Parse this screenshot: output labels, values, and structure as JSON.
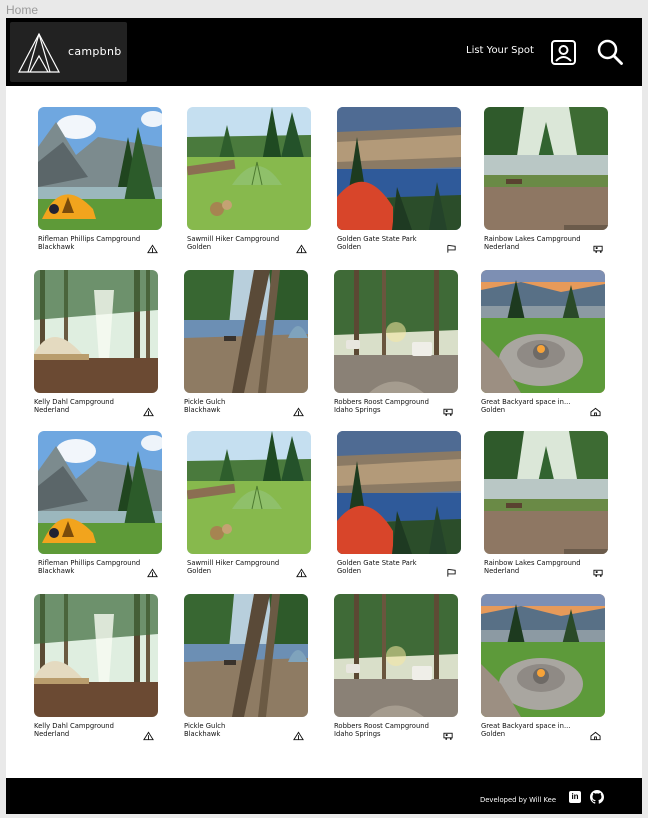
{
  "frame_label": "Home",
  "header": {
    "brand_name": "campbnb",
    "list_spot_label": "List Your Spot",
    "icons": [
      "tent-logo-icon",
      "profile-icon",
      "search-icon"
    ]
  },
  "listings": [
    {
      "title": "Rifleman Phillips Campground",
      "location": "Blackhawk",
      "type_icon": "tent-icon",
      "scene": "mountain-lake"
    },
    {
      "title": "Sawmill Hiker Campground",
      "location": "Golden",
      "type_icon": "tent-icon",
      "scene": "meadow"
    },
    {
      "title": "Golden Gate State Park",
      "location": "Golden",
      "type_icon": "flag-icon",
      "scene": "lake-valley"
    },
    {
      "title": "Rainbow Lakes Campground",
      "location": "Nederland",
      "type_icon": "rv-icon",
      "scene": "pond"
    },
    {
      "title": "Kelly Dahl Campground",
      "location": "Nederland",
      "type_icon": "tent-icon",
      "scene": "forest-tent"
    },
    {
      "title": "Pickle Gulch",
      "location": "Blackhawk",
      "type_icon": "tent-icon",
      "scene": "forest-lake"
    },
    {
      "title": "Robbers Roost Campground",
      "location": "Idaho Springs",
      "type_icon": "rv-icon",
      "scene": "forest-rv"
    },
    {
      "title": "Great Backyard space in...",
      "location": "Golden",
      "type_icon": "house-icon",
      "scene": "backyard"
    },
    {
      "title": "Rifleman Phillips Campground",
      "location": "Blackhawk",
      "type_icon": "tent-icon",
      "scene": "mountain-lake"
    },
    {
      "title": "Sawmill Hiker Campground",
      "location": "Golden",
      "type_icon": "tent-icon",
      "scene": "meadow"
    },
    {
      "title": "Golden Gate State Park",
      "location": "Golden",
      "type_icon": "flag-icon",
      "scene": "lake-valley"
    },
    {
      "title": "Rainbow Lakes Campground",
      "location": "Nederland",
      "type_icon": "rv-icon",
      "scene": "pond"
    },
    {
      "title": "Kelly Dahl Campground",
      "location": "Nederland",
      "type_icon": "tent-icon",
      "scene": "forest-tent"
    },
    {
      "title": "Pickle Gulch",
      "location": "Blackhawk",
      "type_icon": "tent-icon",
      "scene": "forest-lake"
    },
    {
      "title": "Robbers Roost Campground",
      "location": "Idaho Springs",
      "type_icon": "rv-icon",
      "scene": "forest-rv"
    },
    {
      "title": "Great Backyard space in...",
      "location": "Golden",
      "type_icon": "house-icon",
      "scene": "backyard"
    }
  ],
  "footer": {
    "credit": "Developed by Will Kee",
    "icons": [
      "linkedin-icon",
      "github-icon"
    ]
  }
}
